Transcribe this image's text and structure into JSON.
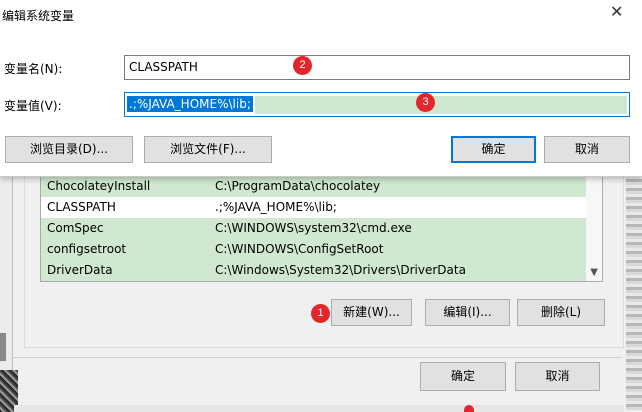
{
  "dialog": {
    "title": "编辑系统变量",
    "close_icon": "✕",
    "name_label": "变量名(N):",
    "name_value": "CLASSPATH",
    "value_label": "变量值(V):",
    "value_value": ".;%JAVA_HOME%\\lib;",
    "browse_dir_label": "浏览目录(D)...",
    "browse_file_label": "浏览文件(F)...",
    "ok_label": "确定",
    "cancel_label": "取消"
  },
  "env_list": {
    "rows": [
      {
        "name": "ChocolateyInstall",
        "value": "C:\\ProgramData\\chocolatey"
      },
      {
        "name": "CLASSPATH",
        "value": ".;%JAVA_HOME%\\lib;"
      },
      {
        "name": "ComSpec",
        "value": "C:\\WINDOWS\\system32\\cmd.exe"
      },
      {
        "name": "configsetroot",
        "value": "C:\\WINDOWS\\ConfigSetRoot"
      },
      {
        "name": "DriverData",
        "value": "C:\\Windows\\System32\\Drivers\\DriverData"
      }
    ],
    "scroll_down_icon": "▼"
  },
  "list_buttons": {
    "new_label": "新建(W)...",
    "edit_label": "编辑(I)...",
    "delete_label": "删除(L)"
  },
  "footer": {
    "ok_label": "确定",
    "cancel_label": "取消"
  },
  "annotations": {
    "badge_1": "1",
    "badge_2": "2",
    "badge_3": "3"
  },
  "colors": {
    "selection_green": "#cfe8cf",
    "accent_blue": "#0078d7",
    "badge_red": "#e3262b"
  }
}
